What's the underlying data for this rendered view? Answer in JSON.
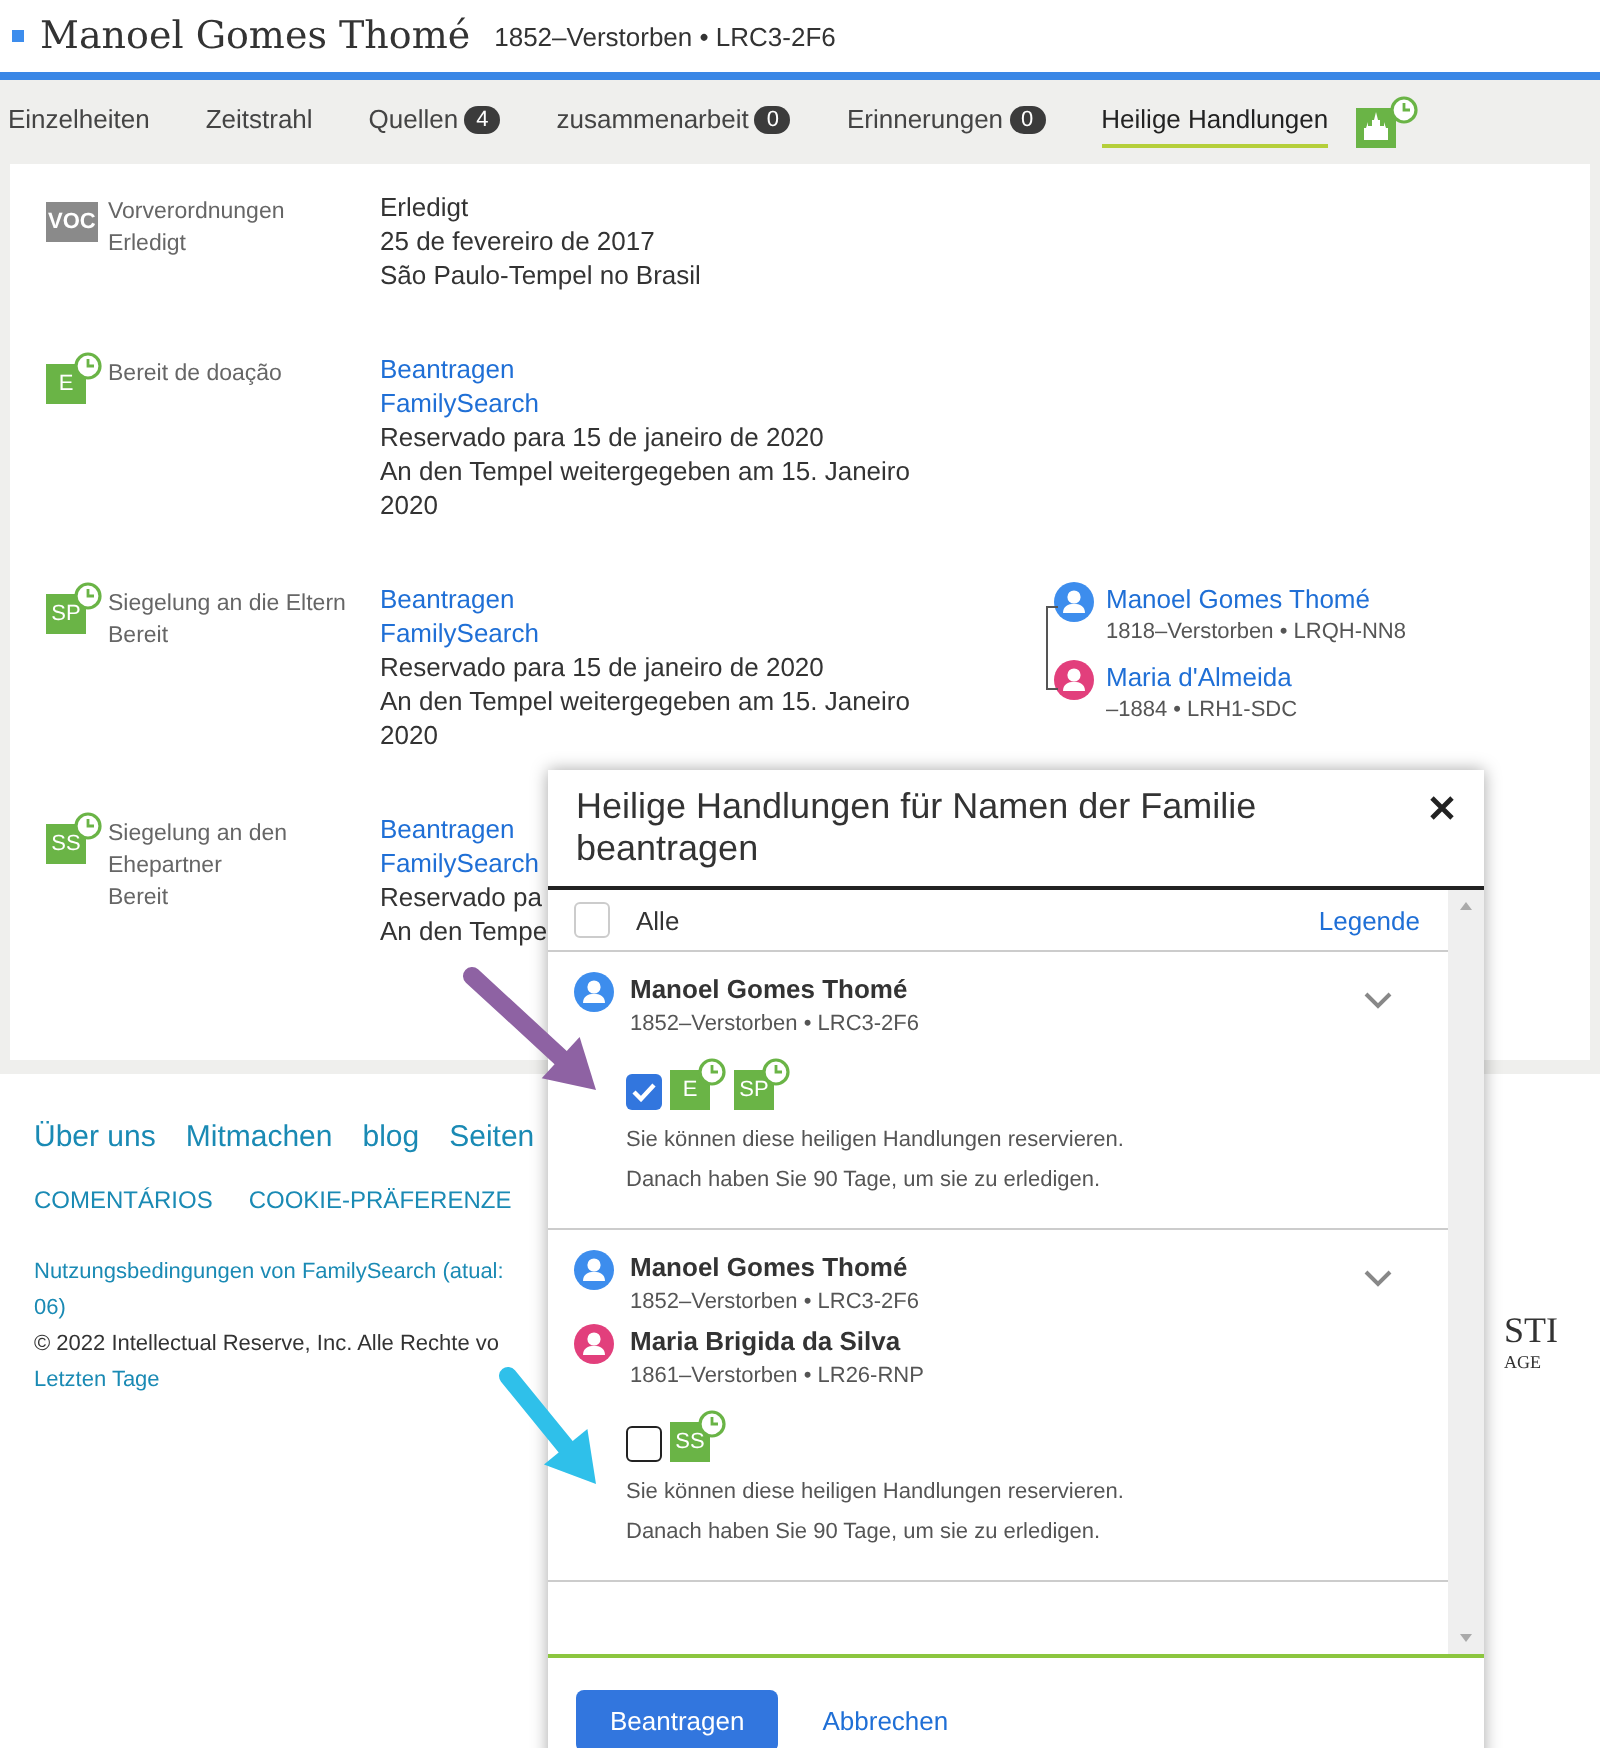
{
  "header": {
    "name": "Manoel Gomes Thomé",
    "meta": "1852–Verstorben • LRC3-2F6"
  },
  "tabs": [
    {
      "label": "Einzelheiten",
      "selected": false
    },
    {
      "label": "Zeitstrahl",
      "selected": false
    },
    {
      "label": "Quellen",
      "count": "4",
      "selected": false
    },
    {
      "label": "zusammenarbeit",
      "count": "0",
      "selected": false
    },
    {
      "label": "Erinnerungen",
      "count": "0",
      "selected": false
    },
    {
      "label": "Heilige Handlungen",
      "selected": true
    }
  ],
  "ordinances": [
    {
      "code": "VOC",
      "kind": "done",
      "name": "Vorverordnungen",
      "status": "Erledigt",
      "details": [
        {
          "kind": "text",
          "text": "Erledigt"
        },
        {
          "kind": "text",
          "text": "25 de fevereiro de 2017"
        },
        {
          "kind": "text",
          "text": "São Paulo-Tempel no Brasil"
        }
      ]
    },
    {
      "code": "E",
      "kind": "reserved",
      "name": "Bereit de doação",
      "details": [
        {
          "kind": "link",
          "text": "Beantragen"
        },
        {
          "kind": "link",
          "text": "FamilySearch"
        },
        {
          "kind": "text",
          "text": "Reservado para 15 de janeiro de 2020"
        },
        {
          "kind": "text",
          "text": "An den Tempel weitergegeben am 15. Janeiro 2020"
        }
      ]
    },
    {
      "code": "SP",
      "kind": "reserved",
      "name": "Siegelung an die Eltern",
      "status": "Bereit",
      "details": [
        {
          "kind": "link",
          "text": "Beantragen"
        },
        {
          "kind": "link",
          "text": "FamilySearch"
        },
        {
          "kind": "text",
          "text": "Reservado para 15 de janeiro de 2020"
        },
        {
          "kind": "text",
          "text": "An den Tempel weitergegeben am 15. Janeiro 2020"
        }
      ],
      "parents": [
        {
          "name": "Manoel Gomes Thomé",
          "meta": "1818–Verstorben • LRQH-NN8",
          "color": "#3d8ded"
        },
        {
          "name": "Maria d'Almeida",
          "meta": "–1884 • LRH1-SDC",
          "color": "#e23f7c"
        }
      ]
    },
    {
      "code": "SS",
      "kind": "reserved",
      "name": "Siegelung an den Ehepartner",
      "status": "Bereit",
      "details": [
        {
          "kind": "link",
          "text": "Beantragen"
        },
        {
          "kind": "link",
          "text": "FamilySearch"
        },
        {
          "kind": "text",
          "text": "Reservado pa"
        },
        {
          "kind": "text",
          "text": "An den Tempe"
        }
      ]
    }
  ],
  "footer": {
    "links": [
      "Über uns",
      "Mitmachen",
      "blog",
      "Seiten"
    ],
    "caps_links": [
      "COMENTÁRIOS",
      "COOKIE-PRÄFERENZE"
    ],
    "terms": "Nutzungsbedingungen von FamilySearch (atual: 06)",
    "copyright": "© 2022 Intellectual Reserve, Inc. Alle Rechte vo",
    "church_link": "Letzten Tage",
    "logo_lines": [
      "STI",
      "AGE"
    ]
  },
  "dialog": {
    "title": "Heilige Handlungen für Namen der Familie beantragen",
    "all": {
      "label": "Alle",
      "checked": false
    },
    "legend": "Legende",
    "groups": [
      {
        "people": [
          {
            "name": "Manoel Gomes Thomé",
            "meta": "1852–Verstorben • LRC3-2F6",
            "color": "#3d8ded"
          }
        ],
        "checked": true,
        "codes": [
          "E",
          "SP"
        ],
        "note": "Sie können diese heiligen Handlungen reservieren. Danach haben Sie 90 Tage, um sie zu erledigen."
      },
      {
        "people": [
          {
            "name": "Manoel Gomes Thomé",
            "meta": "1852–Verstorben • LRC3-2F6",
            "color": "#3d8ded"
          },
          {
            "name": "Maria Brigida da Silva",
            "meta": "1861–Verstorben • LR26-RNP",
            "color": "#e23f7c"
          }
        ],
        "checked": false,
        "codes": [
          "SS"
        ],
        "note": "Sie können diese heiligen Handlungen reservieren. Danach haben Sie 90 Tage, um sie zu erledigen."
      }
    ],
    "primary_button": "Beantragen",
    "cancel": "Abbrechen"
  },
  "annotations": [
    {
      "color": "#8e62a3"
    },
    {
      "color": "#2fc0ea"
    }
  ]
}
